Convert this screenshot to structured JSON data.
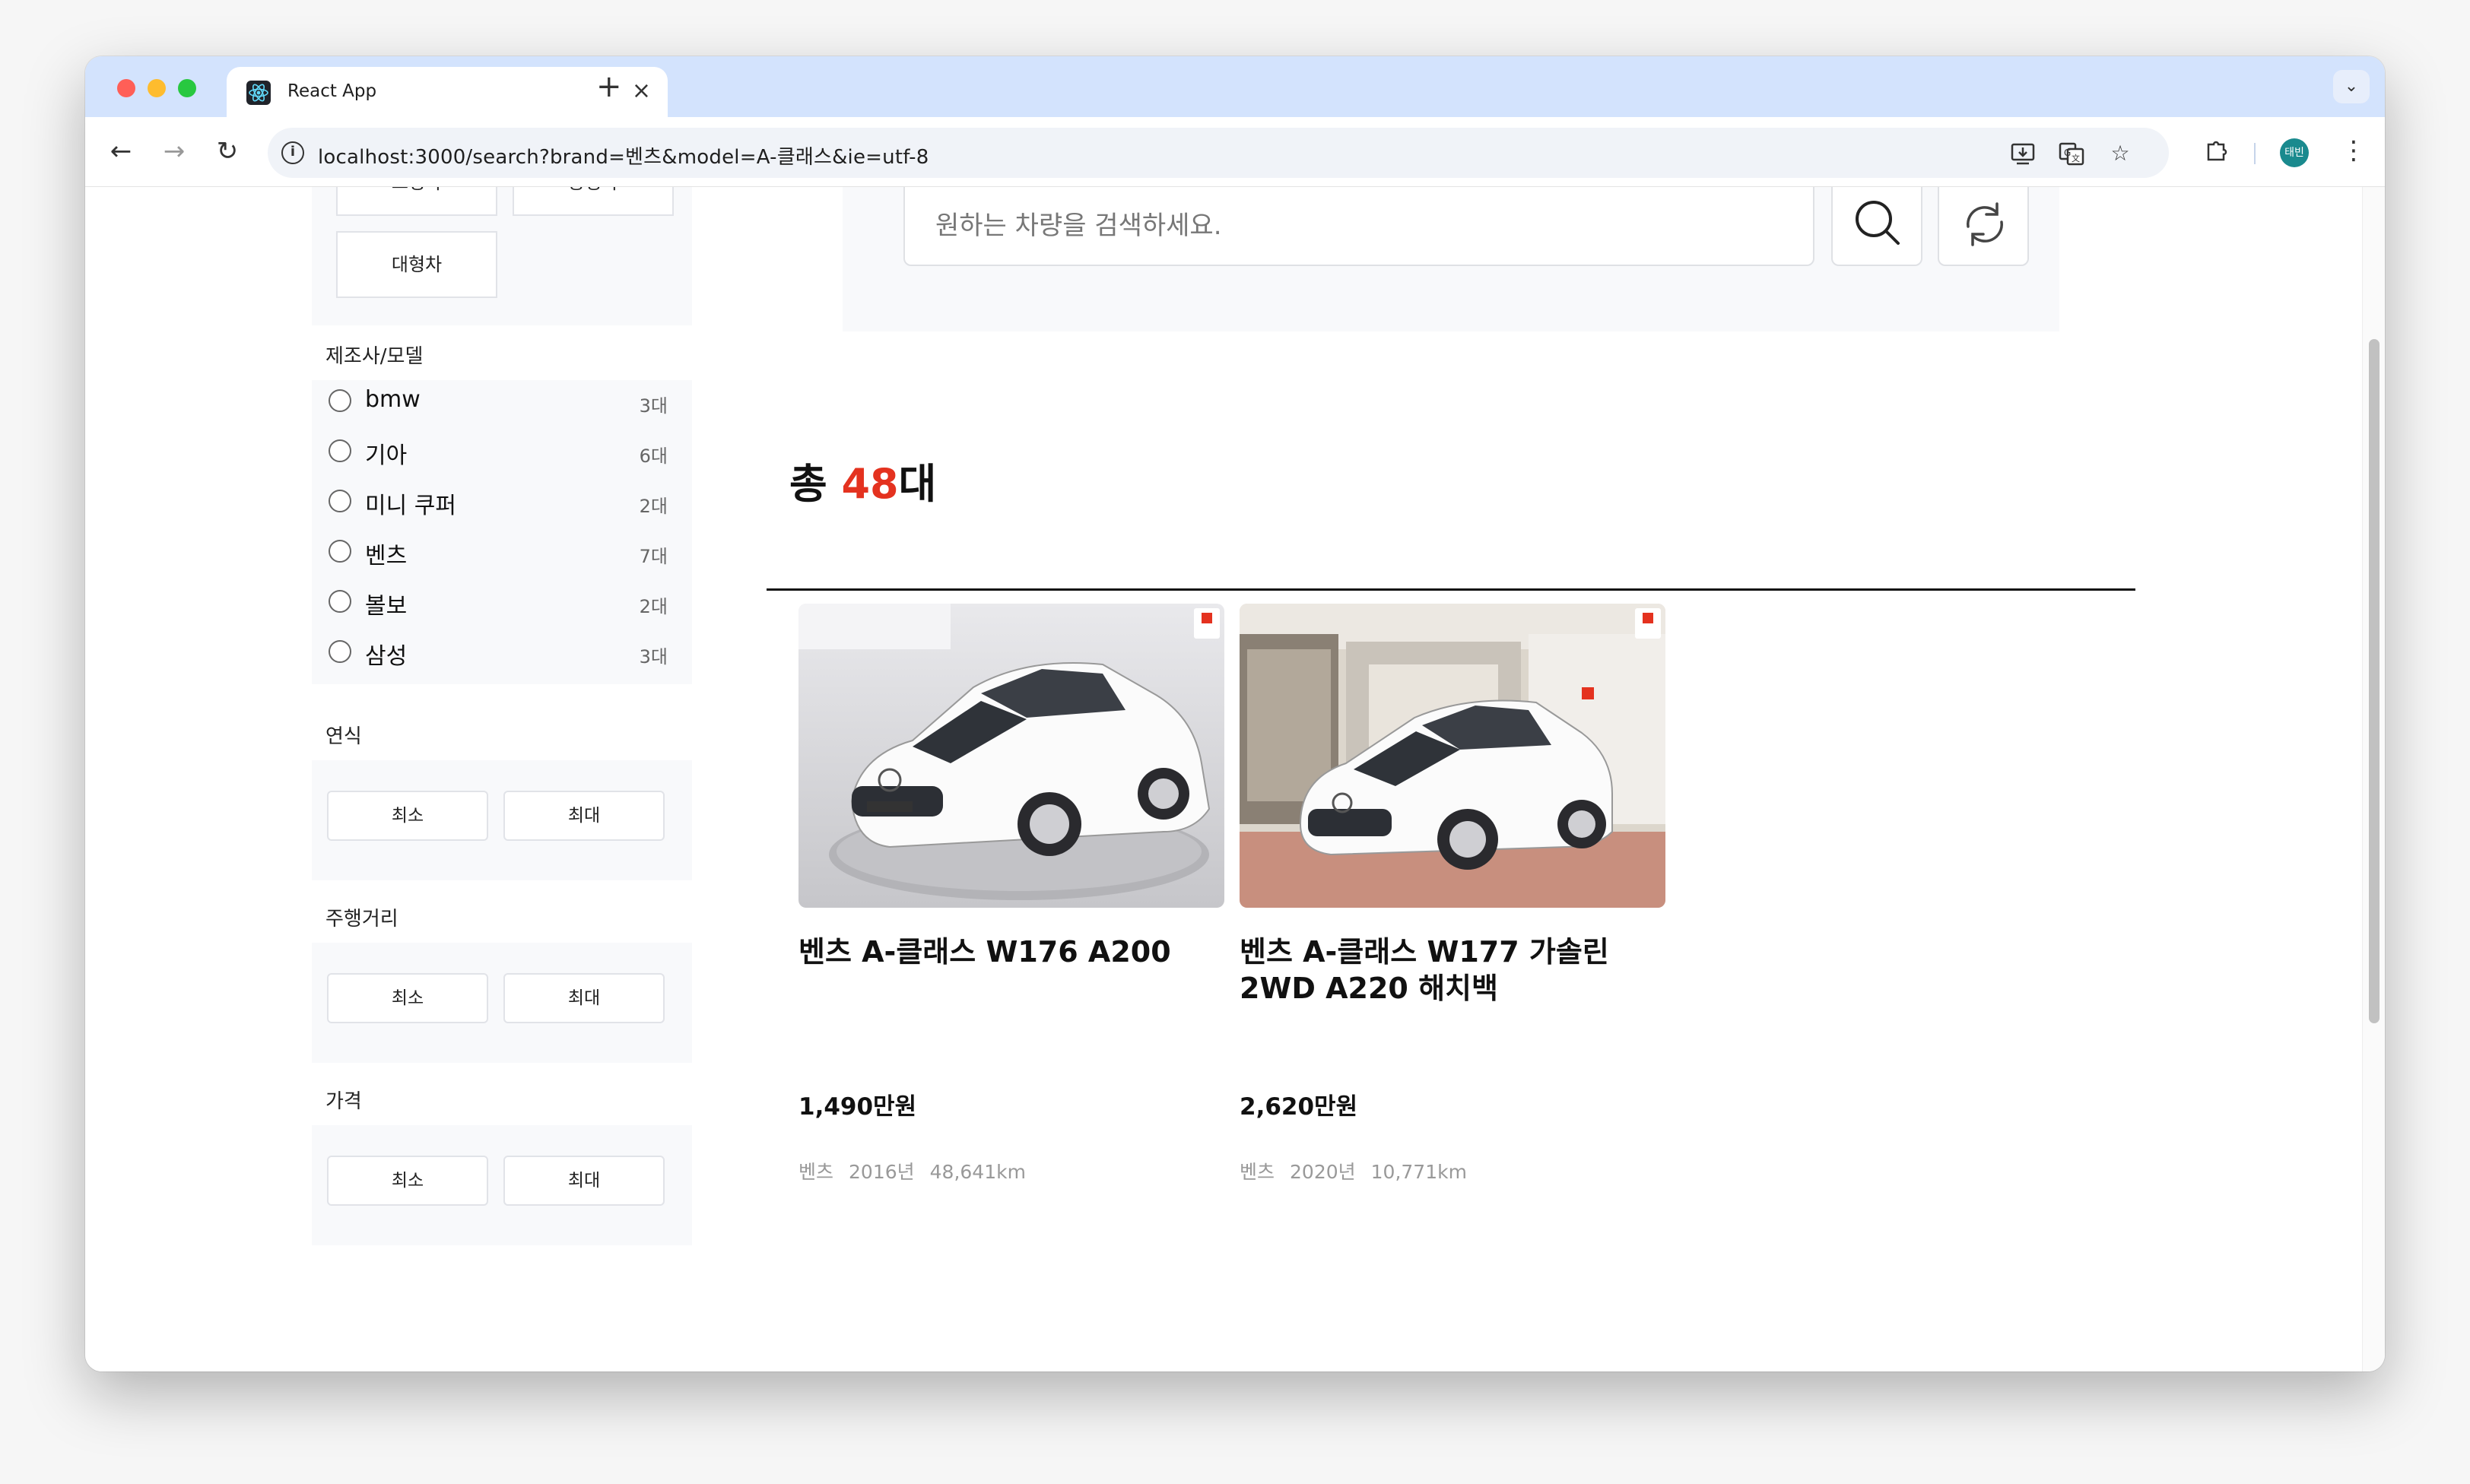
{
  "browser": {
    "tab_title": "React App",
    "tab_close": "×",
    "new_tab": "+",
    "url": "localhost:3000/search?brand=벤츠&model=A-클래스&ie=utf-8",
    "profile_initials": "태빈"
  },
  "search": {
    "placeholder": "원하는 차량을 검색하세요."
  },
  "sidebar": {
    "car_types": [
      {
        "label": "소형차"
      },
      {
        "label": "중형차"
      },
      {
        "label": "대형차"
      }
    ],
    "brand_section_title": "제조사/모델",
    "brands": [
      {
        "name": "bmw",
        "count": "3대"
      },
      {
        "name": "기아",
        "count": "6대"
      },
      {
        "name": "미니 쿠퍼",
        "count": "2대"
      },
      {
        "name": "벤츠",
        "count": "7대"
      },
      {
        "name": "볼보",
        "count": "2대"
      },
      {
        "name": "삼성",
        "count": "3대"
      }
    ],
    "year_title": "연식",
    "mileage_title": "주행거리",
    "price_title": "가격",
    "min_label": "최소",
    "max_label": "최대"
  },
  "results": {
    "total_prefix": "총 ",
    "total_count": "48",
    "total_suffix": "대",
    "cars": [
      {
        "title": "벤츠 A-클래스 W176 A200",
        "price": "1,490만원",
        "brand": "벤츠",
        "year": "2016년",
        "mileage": "48,641km"
      },
      {
        "title": "벤츠 A-클래스 W177 가솔린 2WD A220 해치백",
        "price": "2,620만원",
        "brand": "벤츠",
        "year": "2020년",
        "mileage": "10,771km"
      }
    ]
  },
  "colors": {
    "accent_red": "#e4321f",
    "tab_strip": "#d3e3fd",
    "panel_bg": "#f8f9fb"
  }
}
